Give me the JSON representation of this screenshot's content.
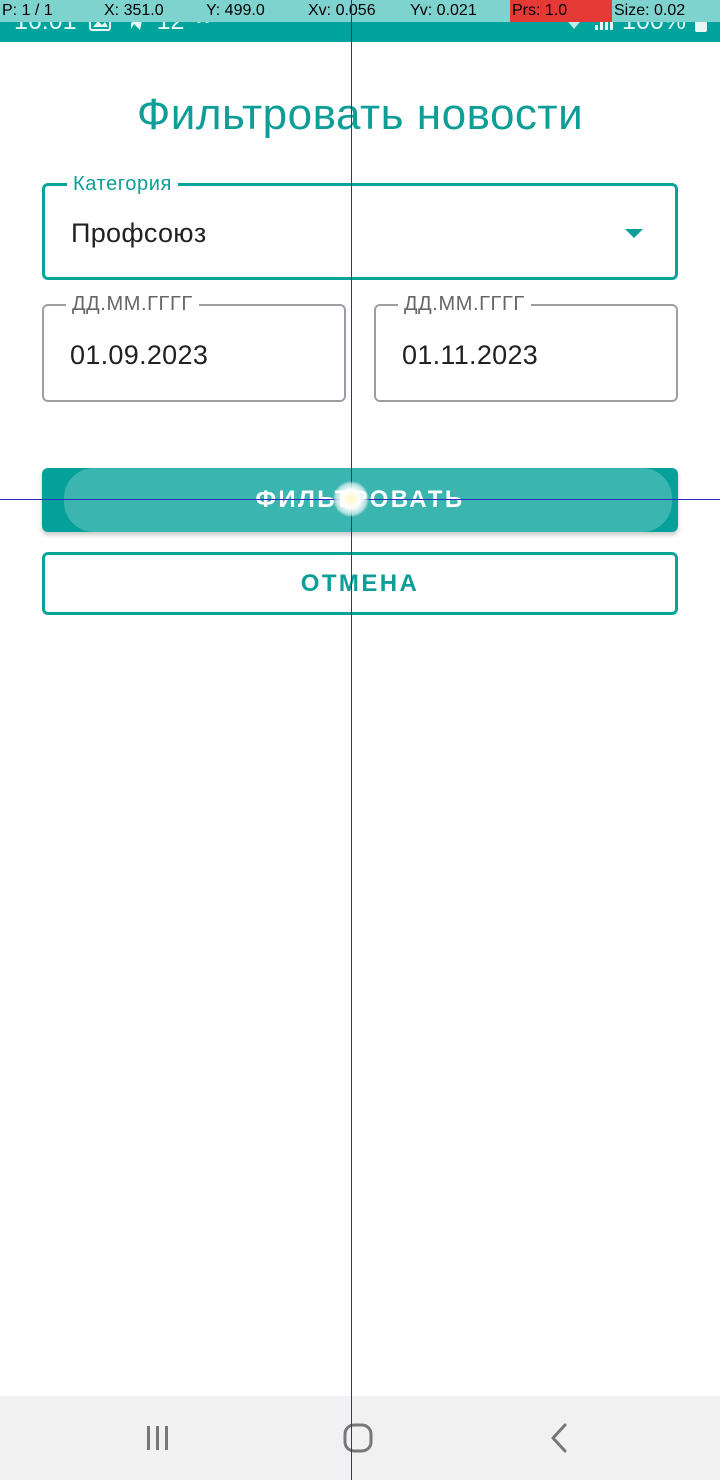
{
  "status_bar": {
    "time": "16:01",
    "notification_count": "12",
    "battery": "100%",
    "colors": {
      "background": "#01a39d"
    }
  },
  "debug_overlay": {
    "pointer": "P: 1 / 1",
    "x": "X: 351.0",
    "y": "Y: 499.0",
    "xv": "Xv: 0.056",
    "yv": "Yv: 0.021",
    "prs": "Prs: 1.0",
    "size": "Size: 0.02"
  },
  "page": {
    "title": "Фильтровать новости",
    "accent_color": "#0f9d97"
  },
  "category": {
    "label": "Категория",
    "value": "Профсоюз",
    "icon": "dropdown-arrow-icon"
  },
  "date_from": {
    "placeholder_label": "ДД.ММ.ГГГГ",
    "value": "01.09.2023"
  },
  "date_to": {
    "placeholder_label": "ДД.ММ.ГГГГ",
    "value": "01.11.2023"
  },
  "actions": {
    "filter_label": "ФИЛЬТРОВАТЬ",
    "cancel_label": "ОТМЕНА"
  },
  "nav_bar": {
    "icons": [
      "recent-apps-icon",
      "home-icon",
      "back-icon"
    ]
  }
}
